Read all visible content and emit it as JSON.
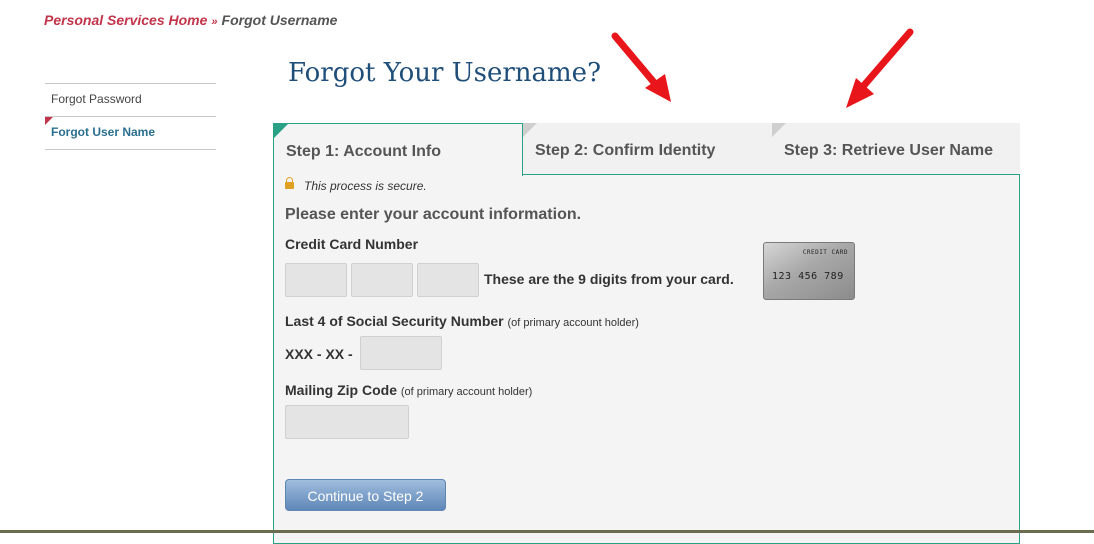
{
  "breadcrumb": {
    "home": "Personal Services Home",
    "separator": "»",
    "current": "Forgot Username"
  },
  "sidebar": {
    "items": [
      {
        "label": "Forgot Password",
        "active": false
      },
      {
        "label": "Forgot User Name",
        "active": true
      }
    ]
  },
  "page": {
    "title": "Forgot Your Username?"
  },
  "steps": [
    {
      "label": "Step 1: Account Info",
      "active": true
    },
    {
      "label": "Step 2: Confirm Identity",
      "active": false
    },
    {
      "label": "Step 3: Retrieve User Name",
      "active": false
    }
  ],
  "form": {
    "secure_note": "This process is secure.",
    "heading": "Please enter your account information.",
    "card_label": "Credit Card Number",
    "card_hint": "These are the 9 digits from your card.",
    "card_image": {
      "label": "CREDIT CARD",
      "number": "123 456 789"
    },
    "ssn_label": "Last 4 of Social Security Number",
    "ssn_note": "(of primary account holder)",
    "ssn_prefix": "XXX - XX -",
    "zip_label": "Mailing Zip Code",
    "zip_note": "(of primary account holder)",
    "fields": {
      "card_part1": "",
      "card_part2": "",
      "card_part3": "",
      "ssn_last4": "",
      "zip": ""
    },
    "continue_label": "Continue to Step 2"
  },
  "icons": {
    "lock": "lock-icon",
    "arrows": [
      "arrow-icon",
      "arrow-icon"
    ]
  },
  "colors": {
    "accent": "#2aa187",
    "breadcrumb": "#c2344a",
    "title": "#1f4e79",
    "button": "#5f87b8",
    "arrow": "#e8161b"
  }
}
